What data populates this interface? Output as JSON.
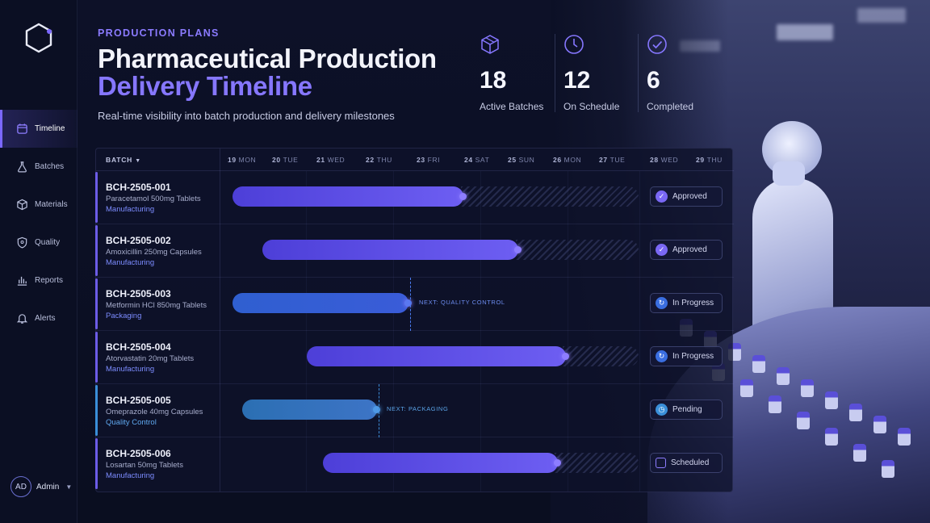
{
  "sidebar": {
    "items": [
      {
        "label": "Timeline",
        "icon": "calendar-icon"
      },
      {
        "label": "Batches",
        "icon": "flask-icon"
      },
      {
        "label": "Materials",
        "icon": "box-icon"
      },
      {
        "label": "Quality",
        "icon": "shield-icon"
      },
      {
        "label": "Reports",
        "icon": "bar-chart-icon"
      },
      {
        "label": "Alerts",
        "icon": "bell-icon"
      }
    ],
    "active": "Timeline",
    "user": {
      "initials": "AD",
      "name": "Admin"
    }
  },
  "header": {
    "eyebrow": "PRODUCTION PLANS",
    "title_line1": "Pharmaceutical Production",
    "title_line2": "Delivery Timeline",
    "subtitle": "Real-time visibility into batch production and delivery milestones"
  },
  "stats": [
    {
      "value": "18",
      "label": "Active Batches",
      "icon": "cube-icon"
    },
    {
      "value": "12",
      "label": "On Schedule",
      "icon": "clock-icon"
    },
    {
      "value": "6",
      "label": "Completed",
      "icon": "check-circle-icon"
    }
  ],
  "timeline": {
    "batch_header": "BATCH",
    "days": [
      {
        "num": "19",
        "name": "MON"
      },
      {
        "num": "20",
        "name": "TUE"
      },
      {
        "num": "21",
        "name": "WED"
      },
      {
        "num": "22",
        "name": "THU"
      },
      {
        "num": "23",
        "name": "FRI"
      },
      {
        "num": "24",
        "name": "SAT"
      },
      {
        "num": "25",
        "name": "SUN"
      },
      {
        "num": "26",
        "name": "MON"
      },
      {
        "num": "27",
        "name": "TUE"
      },
      {
        "num": "28",
        "name": "WED"
      },
      {
        "num": "29",
        "name": "THU"
      }
    ],
    "rows": [
      {
        "code": "BCH-2505-001",
        "drug": "Paracetamol 500mg Tablets",
        "stage": "Manufacturing",
        "status": "Approved",
        "next": ""
      },
      {
        "code": "BCH-2505-002",
        "drug": "Amoxicillin 250mg Capsules",
        "stage": "Manufacturing",
        "status": "Approved",
        "next": ""
      },
      {
        "code": "BCH-2505-003",
        "drug": "Metformin HCl 850mg Tablets",
        "stage": "Packaging",
        "status": "In Progress",
        "next": "NEXT: QUALITY CONTROL"
      },
      {
        "code": "BCH-2505-004",
        "drug": "Atorvastatin 20mg Tablets",
        "stage": "Manufacturing",
        "status": "In Progress",
        "next": ""
      },
      {
        "code": "BCH-2505-005",
        "drug": "Omeprazole 40mg Capsules",
        "stage": "Quality Control",
        "status": "Pending",
        "next": "NEXT: PACKAGING"
      },
      {
        "code": "BCH-2505-006",
        "drug": "Losartan 50mg Tablets",
        "stage": "Manufacturing",
        "status": "Scheduled",
        "next": ""
      }
    ]
  },
  "colors": {
    "accent": "#7b68ff",
    "background": "#0b0f22",
    "progress": "#3a6ee0",
    "pending": "#3a8fd9"
  }
}
